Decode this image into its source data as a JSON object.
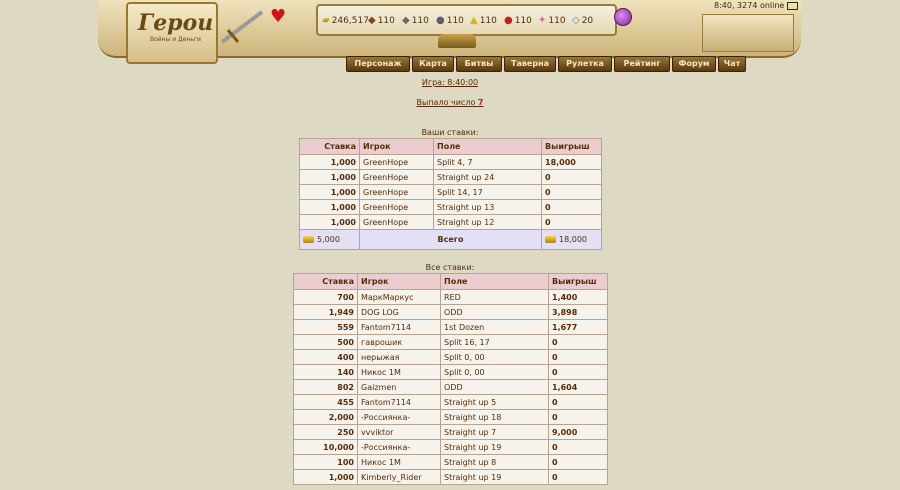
{
  "header": {
    "logo_title": "Герои",
    "logo_subtitle": "Войны и Деньги",
    "online_status": "8:40, 3274 online",
    "resources": [
      {
        "icon": "gold-icon",
        "value": "246,517"
      },
      {
        "icon": "wood-icon",
        "value": "110"
      },
      {
        "icon": "ore-icon",
        "value": "110"
      },
      {
        "icon": "mercury-icon",
        "value": "110"
      },
      {
        "icon": "sulfur-icon",
        "value": "110"
      },
      {
        "icon": "crystal-icon",
        "value": "110"
      },
      {
        "icon": "gems-icon",
        "value": "110"
      },
      {
        "icon": "diamond-icon",
        "value": "20"
      }
    ],
    "menu": [
      "Персонаж",
      "Карта",
      "Битвы",
      "Таверна",
      "Рулетка",
      "Рейтинг",
      "Форум",
      "Чат"
    ]
  },
  "game_time": "Игра: 8:40:00",
  "result": {
    "label": "Выпало число",
    "number": "7"
  },
  "your_bets": {
    "caption": "Ваши ставки:",
    "headers": [
      "Ставка",
      "Игрок",
      "Поле",
      "Выигрыш"
    ],
    "rows": [
      [
        "1,000",
        "GreenHope",
        "Split 4, 7",
        "18,000"
      ],
      [
        "1,000",
        "GreenHope",
        "Straight up 24",
        "0"
      ],
      [
        "1,000",
        "GreenHope",
        "Split 14, 17",
        "0"
      ],
      [
        "1,000",
        "GreenHope",
        "Straight up 13",
        "0"
      ],
      [
        "1,000",
        "GreenHope",
        "Straight up 12",
        "0"
      ]
    ],
    "total": {
      "stake": "5,000",
      "label": "Всего",
      "win": "18,000"
    }
  },
  "all_bets": {
    "caption": "Все ставки:",
    "headers": [
      "Ставка",
      "Игрок",
      "Поле",
      "Выигрыш"
    ],
    "rows": [
      [
        "700",
        "МаркМаркус",
        "RED",
        "1,400"
      ],
      [
        "1,949",
        "DOG LOG",
        "ODD",
        "3,898"
      ],
      [
        "559",
        "Fantom7114",
        "1st Dozen",
        "1,677"
      ],
      [
        "500",
        "гаврошик",
        "Split 16, 17",
        "0"
      ],
      [
        "400",
        "нерыжая",
        "Split 0, 00",
        "0"
      ],
      [
        "140",
        "Никос 1M",
        "Split 0, 00",
        "0"
      ],
      [
        "802",
        "Gaizmen",
        "ODD",
        "1,604"
      ],
      [
        "455",
        "Fantom7114",
        "Straight up 5",
        "0"
      ],
      [
        "2,000",
        "-Россиянка-",
        "Straight up 18",
        "0"
      ],
      [
        "250",
        "vvviktor",
        "Straight up 7",
        "9,000"
      ],
      [
        "10,000",
        "-Россиянка-",
        "Straight up 19",
        "0"
      ],
      [
        "100",
        "Никос 1M",
        "Straight up 8",
        "0"
      ],
      [
        "1,000",
        "Kimberly_Rider",
        "Straight up 19",
        "0"
      ]
    ]
  }
}
